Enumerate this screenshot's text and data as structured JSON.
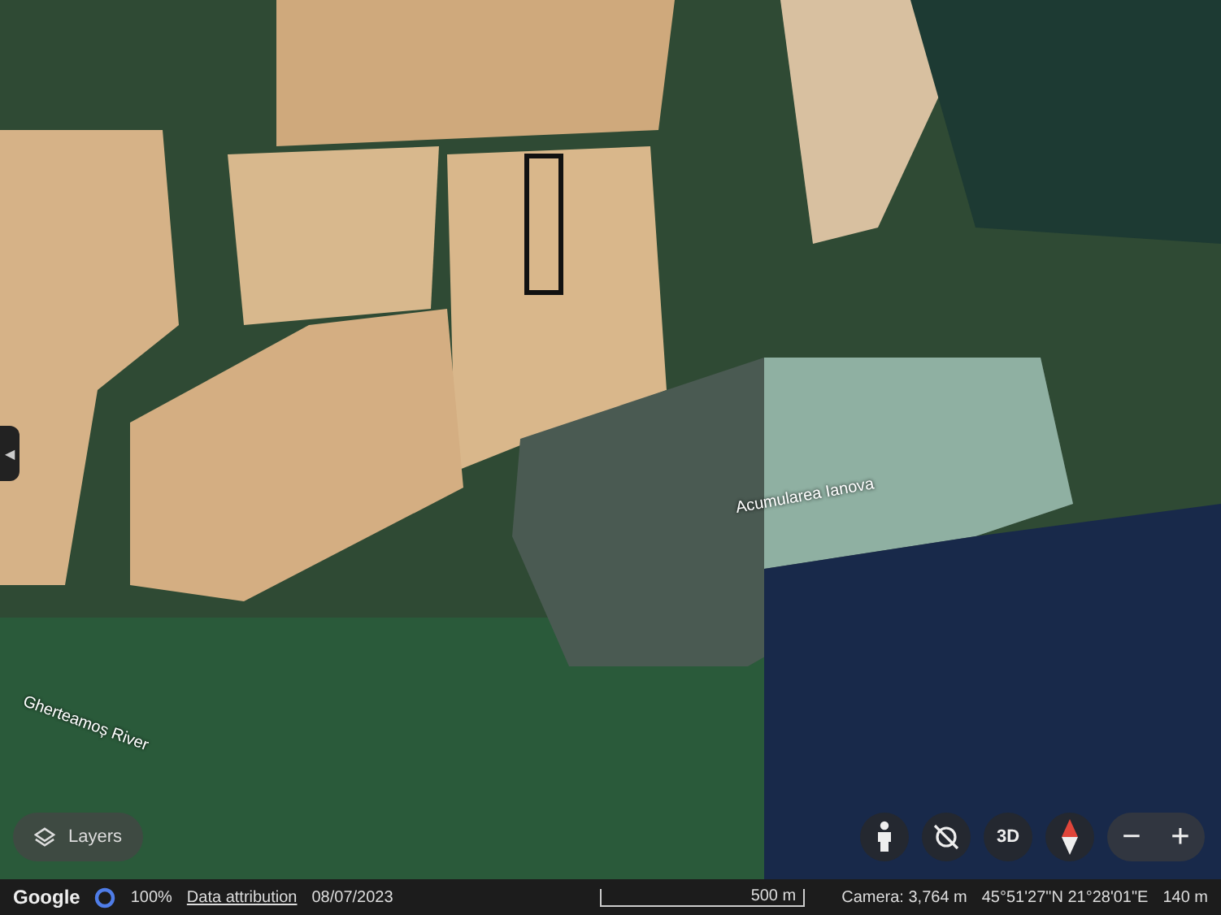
{
  "map": {
    "labels": [
      {
        "text": "Acumularea Ianova",
        "kind": "water"
      },
      {
        "text": "Gherteamoș River",
        "kind": "river"
      }
    ]
  },
  "side_panel_toggle": {
    "glyph": "◀"
  },
  "layers_button": {
    "label": "Layers"
  },
  "map_controls": {
    "view_3d": "3D",
    "zoom_out": "−",
    "zoom_in": "+"
  },
  "status_bar": {
    "logo": "Google",
    "loading": "100%",
    "attribution_link": "Data attribution",
    "date": "08/07/2023",
    "scale": "500 m",
    "camera": "Camera: 3,764 m",
    "coordinates": "45°51'27\"N 21°28'01\"E",
    "elevation": "140 m"
  }
}
